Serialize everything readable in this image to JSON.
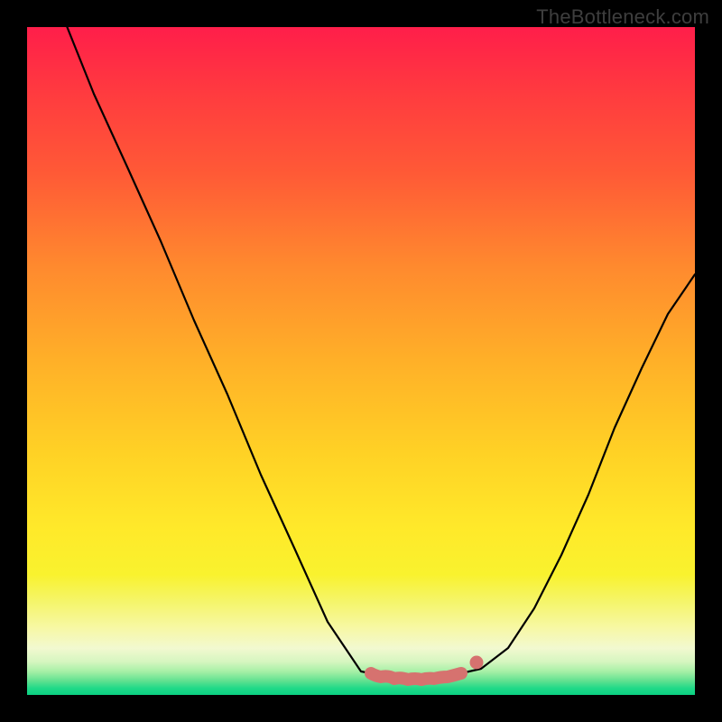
{
  "watermark": "TheBottleneck.com",
  "chart_data": {
    "type": "line",
    "title": "",
    "xlabel": "",
    "ylabel": "",
    "xlim": [
      0,
      100
    ],
    "ylim": [
      0,
      100
    ],
    "grid": false,
    "legend": false,
    "series": [
      {
        "name": "left-falling-curve",
        "x": [
          6,
          10,
          15,
          20,
          25,
          30,
          35,
          40,
          45,
          50,
          51.5
        ],
        "values": [
          100,
          90,
          79,
          68,
          56,
          45,
          33,
          22,
          11,
          3.5,
          3.2
        ]
      },
      {
        "name": "right-rising-curve",
        "x": [
          65,
          68,
          72,
          76,
          80,
          84,
          88,
          92,
          96,
          100
        ],
        "values": [
          3.2,
          4.0,
          7,
          13,
          21,
          30,
          40,
          49,
          57,
          63
        ]
      },
      {
        "name": "pink-bottom-segment",
        "color": "#d6726f",
        "x": [
          51.5,
          53,
          55,
          57,
          59,
          61,
          63,
          65
        ],
        "values": [
          3.2,
          2.7,
          2.4,
          2.3,
          2.3,
          2.4,
          2.7,
          3.2
        ]
      },
      {
        "name": "pink-right-dot",
        "color": "#d6726f",
        "x": [
          67.3
        ],
        "values": [
          4.8
        ]
      }
    ],
    "background_gradient_stops": [
      {
        "pos": 0.0,
        "color": "#ff1e4a"
      },
      {
        "pos": 0.5,
        "color": "#ffb028"
      },
      {
        "pos": 0.82,
        "color": "#f5f22e"
      },
      {
        "pos": 0.93,
        "color": "#f2f9d0"
      },
      {
        "pos": 1.0,
        "color": "#0bd182"
      }
    ]
  }
}
